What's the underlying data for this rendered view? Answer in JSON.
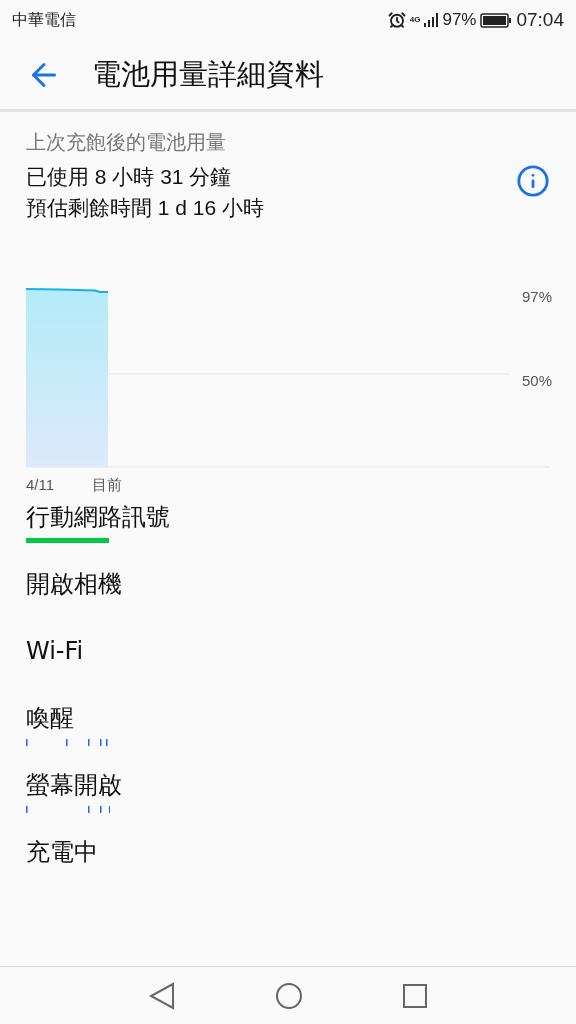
{
  "status_bar": {
    "carrier": "中華電信",
    "network": "4G",
    "battery": "97%",
    "time": "07:04"
  },
  "header": {
    "title": "電池用量詳細資料"
  },
  "summary": {
    "caption": "上次充飽後的電池用量",
    "used": "已使用 8 小時 31 分鐘",
    "remaining": "預估剩餘時間 1 d 16 小時"
  },
  "chart": {
    "y_labels": [
      "97%",
      "50%"
    ],
    "x_labels": [
      "4/11",
      "目前"
    ]
  },
  "items": [
    {
      "label": "行動網路訊號",
      "kind": "bar",
      "color": "#00c94a"
    },
    {
      "label": "開啟相機",
      "kind": "plain"
    },
    {
      "label": "Wi-Fi",
      "kind": "plain"
    },
    {
      "label": "喚醒",
      "kind": "ticks",
      "color": "#1a66ff"
    },
    {
      "label": "螢幕開啟",
      "kind": "ticks",
      "color": "#1a66ff"
    },
    {
      "label": "充電中",
      "kind": "plain"
    }
  ]
}
